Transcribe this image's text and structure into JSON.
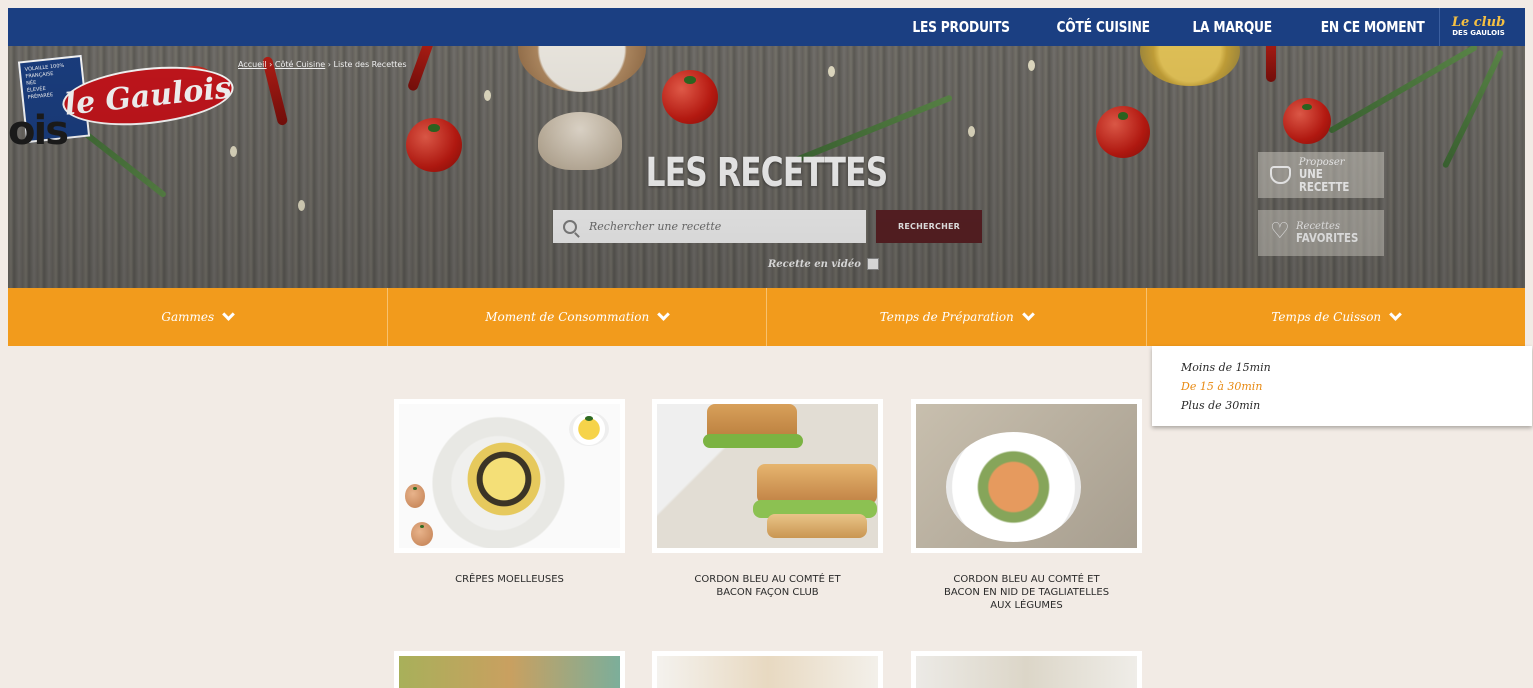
{
  "nav": {
    "items": [
      "LES PRODUITS",
      "CÔTÉ CUISINE",
      "LA MARQUE",
      "EN CE MOMENT"
    ],
    "club_line1": "Le club",
    "club_line2": "DES GAULOIS"
  },
  "logo": {
    "name": "le Gaulois",
    "flag_top": "VOLAILLE 100% FRANÇAISE",
    "flag_lines": [
      "NÉE",
      "ÉLEVÉE",
      "PRÉPARÉE"
    ]
  },
  "breadcrumb": {
    "home": "Accueil",
    "section": "Côté Cuisine",
    "current": "Liste des Recettes"
  },
  "ghost_text": "ois",
  "hero": {
    "title": "LES RECETTES",
    "search_placeholder": "Rechercher une recette",
    "search_button": "RECHERCHER",
    "video_label": "Recette en vidéo",
    "propose_small": "Proposer",
    "propose_big": "UNE RECETTE",
    "fav_small": "Recettes",
    "fav_big": "FAVORITES"
  },
  "filters": [
    "Gammes",
    "Moment de Consommation",
    "Temps de Préparation",
    "Temps de Cuisson"
  ],
  "cooking_time_options": [
    "Moins de 15min",
    "De 15 à 30min",
    "Plus de 30min"
  ],
  "cooking_time_active": 1,
  "recipes": [
    {
      "name": "CRÊPES MOELLEUSES"
    },
    {
      "name": "CORDON BLEU AU COMTÉ ET BACON FAÇON CLUB"
    },
    {
      "name": "CORDON BLEU AU COMTÉ ET BACON EN NID DE TAGLIATELLES AUX LÉGUMES"
    }
  ],
  "colors": {
    "nav_blue": "#1b3f82",
    "filter_orange": "#f29b1c",
    "search_button": "#5e2226",
    "page_bg": "#f2ebe5",
    "active_option": "#e88a13"
  }
}
